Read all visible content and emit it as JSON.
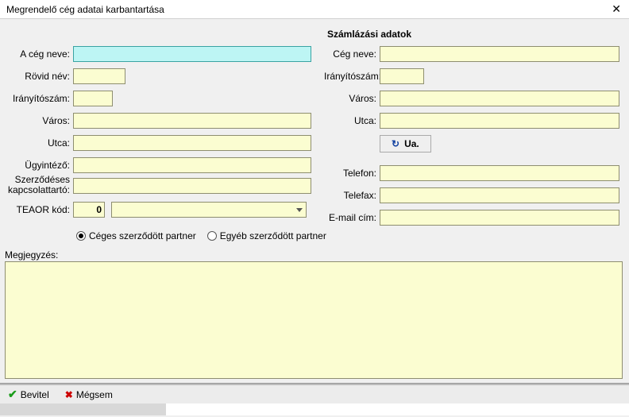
{
  "window": {
    "title": "Megrendelő cég adatai karbantartása"
  },
  "left": {
    "ceg_neve_label": "A cég neve:",
    "ceg_neve_value": "",
    "rovid_nev_label": "Rövid név:",
    "rovid_nev_value": "",
    "irsz_label": "Irányítószám:",
    "irsz_value": "",
    "varos_label": "Város:",
    "varos_value": "",
    "utca_label": "Utca:",
    "utca_value": "",
    "ugyintezo_label": "Ügyintéző:",
    "ugyintezo_value": "",
    "kapcs_label_l1": "Szerződéses",
    "kapcs_label_l2": "kapcsolattartó:",
    "kapcs_value": "",
    "teaor_label": "TEAOR kód:",
    "teaor_value": "0",
    "teaor_select": ""
  },
  "partner": {
    "ceges_label": "Céges szerződött partner",
    "egyeb_label": "Egyéb szerződött partner",
    "selected": "ceges"
  },
  "right": {
    "section_title": "Számlázási adatok",
    "ceg_neve_label": "Cég neve:",
    "ceg_neve_value": "",
    "irsz_label": "Irányítószám:",
    "irsz_value": "",
    "varos_label": "Város:",
    "varos_value": "",
    "utca_label": "Utca:",
    "utca_value": "",
    "ua_button": "Ua.",
    "telefon_label": "Telefon:",
    "telefon_value": "",
    "telefax_label": "Telefax:",
    "telefax_value": "",
    "email_label": "E-mail cím:",
    "email_value": ""
  },
  "notes": {
    "label": "Megjegyzés:",
    "value": ""
  },
  "footer": {
    "ok": "Bevitel",
    "cancel": "Mégsem"
  }
}
